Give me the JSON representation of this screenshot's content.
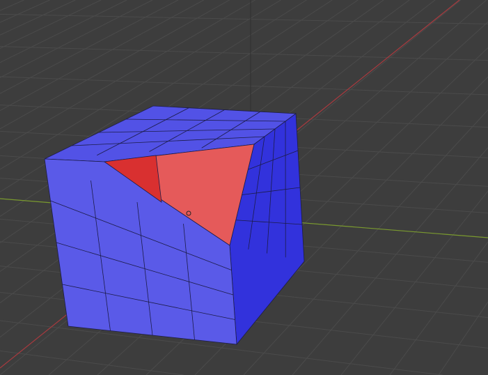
{
  "viewport": {
    "background": "#3d3d3d",
    "grid_color": "#4a4a4a",
    "x_axis_color": "#a83a3f",
    "y_axis_color": "#7a9a2e",
    "z_axis_color": "#2a2a2a"
  },
  "mesh": {
    "face_color_top": "#5252e6",
    "face_color_front": "#5a5ae8",
    "face_color_side": "#3232dc",
    "selected_face_color": "#e55a5a",
    "selected_face_dark": "#d93030",
    "edge_color": "#1a1a40"
  }
}
